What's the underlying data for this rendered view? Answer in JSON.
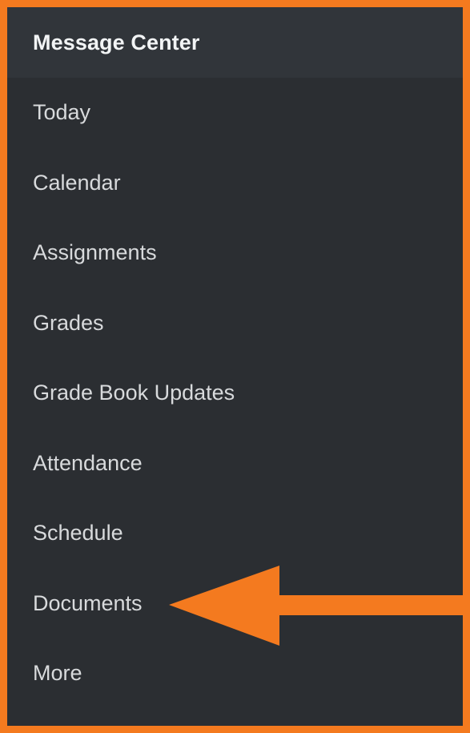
{
  "menu": {
    "header_label": "Message Center",
    "items": [
      {
        "label": "Today"
      },
      {
        "label": "Calendar"
      },
      {
        "label": "Assignments"
      },
      {
        "label": "Grades"
      },
      {
        "label": "Grade Book Updates"
      },
      {
        "label": "Attendance"
      },
      {
        "label": "Schedule"
      },
      {
        "label": "Documents"
      },
      {
        "label": "More"
      }
    ]
  },
  "annotation": {
    "icon": "arrow-left-icon",
    "target": "Documents",
    "color": "#f47a1f"
  },
  "colors": {
    "frame_border": "#f47a1f",
    "menu_background": "#2b2e32",
    "header_background": "#31353a",
    "text_primary": "#f2f4f5",
    "text_secondary": "#d8dadc"
  }
}
